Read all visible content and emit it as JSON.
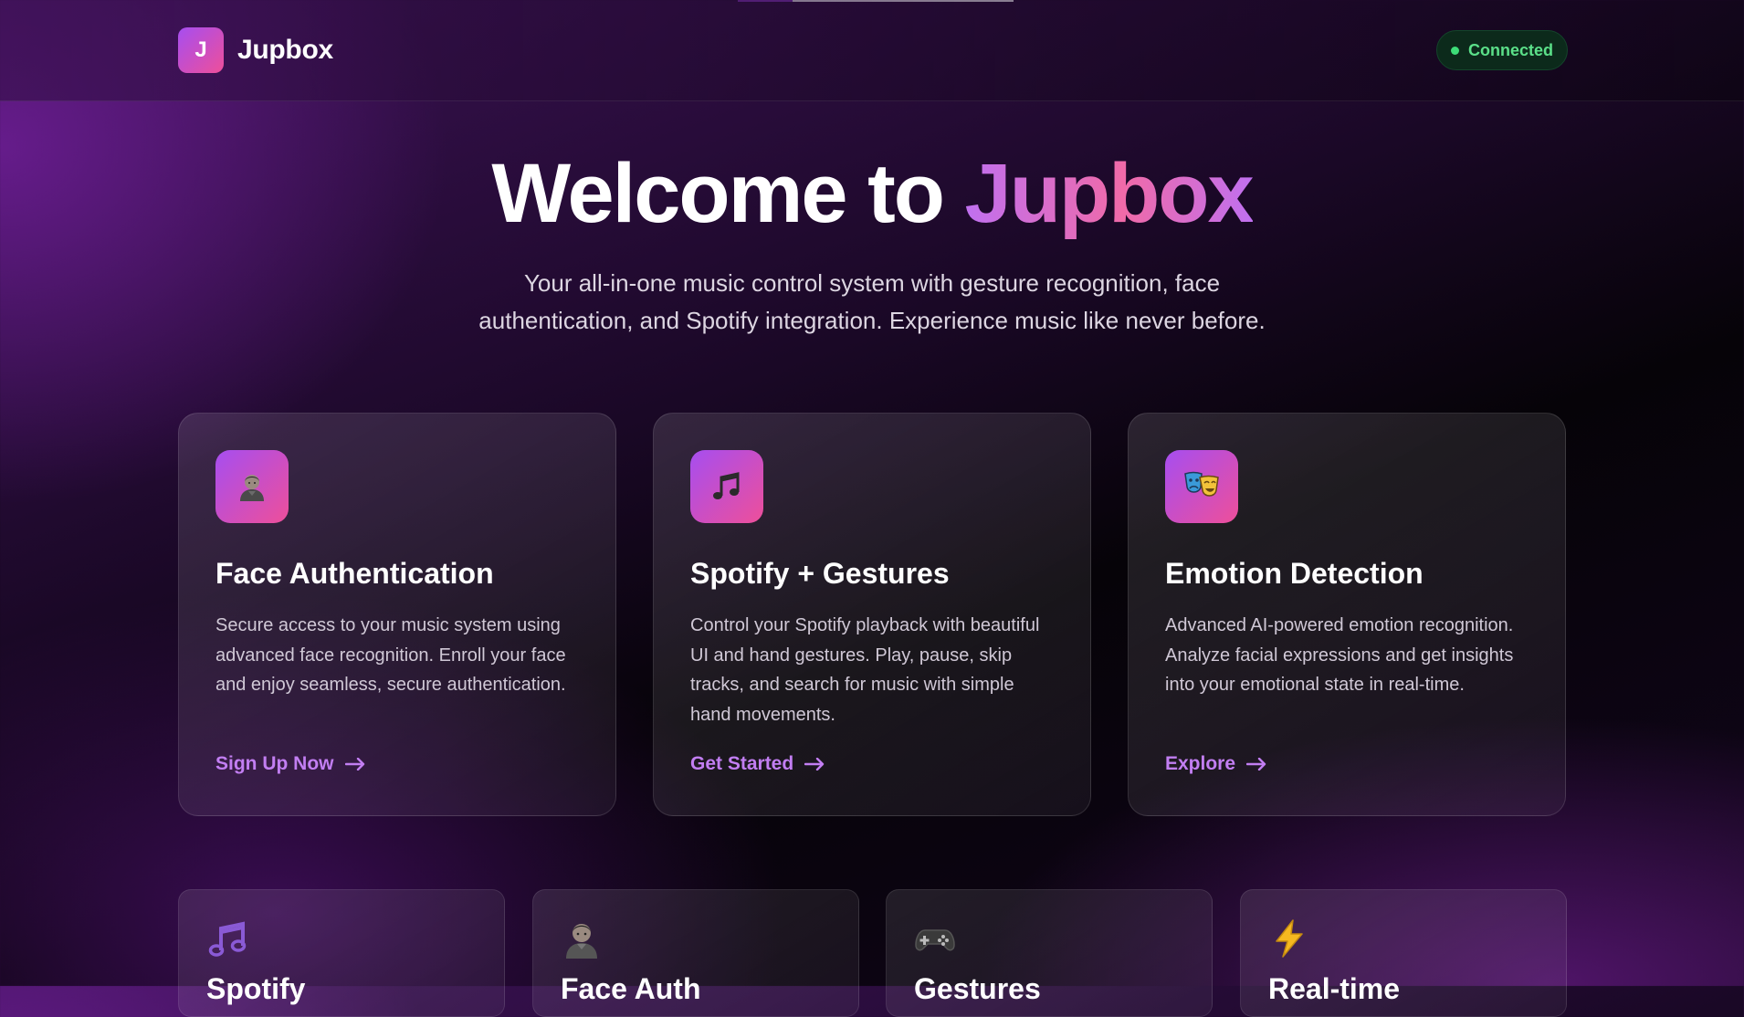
{
  "brand": {
    "mark": "J",
    "name": "Jupbox"
  },
  "status": {
    "label": "Connected",
    "color": "#3ddc78"
  },
  "hero": {
    "title_prefix": "Welcome to ",
    "title_accent": "Jupbox",
    "subtitle_line1": "Your all-in-one music control system with gesture recognition, face",
    "subtitle_line2": "authentication, and Spotify integration. Experience music like never before."
  },
  "features": [
    {
      "icon": "person-icon",
      "title": "Face Authentication",
      "description": "Secure access to your music system using advanced face recognition. Enroll your face and enjoy seamless, secure authentication.",
      "link": "Sign Up Now"
    },
    {
      "icon": "music-note-icon",
      "title": "Spotify + Gestures",
      "description": "Control your Spotify playback with beautiful UI and hand gestures. Play, pause, skip tracks, and search for music with simple hand movements.",
      "link": "Get Started"
    },
    {
      "icon": "theater-masks-icon",
      "title": "Emotion Detection",
      "description": "Advanced AI-powered emotion recognition. Analyze facial expressions and get insights into your emotional state in real-time.",
      "link": "Explore"
    }
  ],
  "mini_features": [
    {
      "icon": "music-note-icon",
      "title": "Spotify"
    },
    {
      "icon": "person-icon",
      "title": "Face Auth"
    },
    {
      "icon": "gamepad-icon",
      "title": "Gestures"
    },
    {
      "icon": "lightning-icon",
      "title": "Real-time"
    }
  ],
  "colors": {
    "accent_gradient_start": "#a64ef0",
    "accent_gradient_end": "#ee4f9a",
    "link": "#c27ef2",
    "status_text": "#5be089"
  }
}
